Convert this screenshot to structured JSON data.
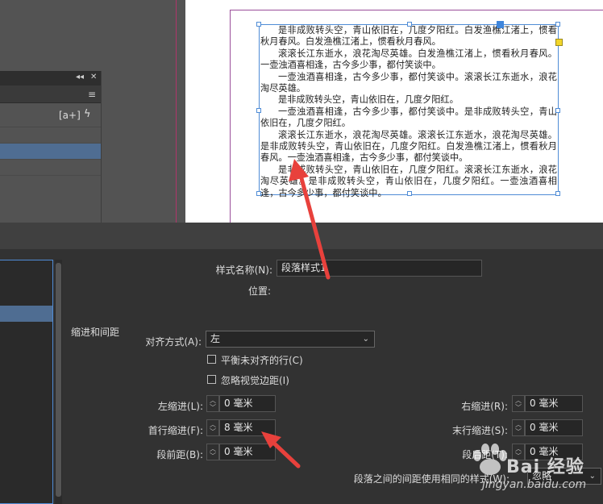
{
  "document": {
    "paragraphs": [
      "是非成败转头空，青山依旧在，几度夕阳红。白发渔樵江渚上，惯看秋月春风。白发渔樵江渚上，惯看秋月春风。",
      "滚滚长江东逝水，浪花淘尽英雄。白发渔樵江渚上，惯看秋月春风。一壶浊酒喜相逢，古今多少事，都付笑谈中。",
      "一壶浊酒喜相逢，古今多少事，都付笑谈中。滚滚长江东逝水，浪花淘尽英雄。",
      "是非成败转头空，青山依旧在，几度夕阳红。",
      "一壶浊酒喜相逢，古今多少事，都付笑谈中。是非成败转头空，青山依旧在，几度夕阳红。",
      "滚滚长江东逝水，浪花淘尽英雄。滚滚长江东逝水，浪花淘尽英雄。是非成败转头空，青山依旧在，几度夕阳红。白发渔樵江渚上，惯看秋月春风。一壶浊酒喜相逢，古今多少事，都付笑谈中。",
      "是非成败转头空，青山依旧在，几度夕阳红。滚滚长江东逝水，浪花淘尽英雄。是非成败转头空，青山依旧在，几度夕阳红。一壶浊酒喜相逢，古今多少事，都付笑谈中。"
    ]
  },
  "panel": {
    "icons": [
      "collapse-icon",
      "close-icon",
      "menu-icon",
      "text-insert-icon",
      "lightning-icon"
    ],
    "collapse_glyph": "◂◂",
    "close_glyph": "✕",
    "menu_glyph": "≡",
    "tool1": "[a+]",
    "tool2": "ϟ"
  },
  "dialog": {
    "style_name_label": "样式名称(N):",
    "style_name_value": "段落样式1",
    "location_label": "位置:",
    "section_title": "缩进和间距",
    "align_label": "对齐方式(A):",
    "align_value": "左",
    "balance_label": "平衡未对齐的行(C)",
    "ignore_margin_label": "忽略视觉边距(I)",
    "left_indent_label": "左缩进(L):",
    "left_indent_value": "0 毫米",
    "right_indent_label": "右缩进(R):",
    "right_indent_value": "0 毫米",
    "first_indent_label": "首行缩进(F):",
    "first_indent_value": "8 毫米",
    "last_indent_label": "末行缩进(S):",
    "last_indent_value": "0 毫米",
    "space_before_label": "段前距(B):",
    "space_before_value": "0 毫米",
    "space_after_label": "段后距(T):",
    "space_after_value": "0 毫米",
    "same_style_label": "段落之间的间距使用相同的样式(W):",
    "same_style_value": "忽略"
  },
  "watermark": {
    "brand": "Bai  经验",
    "url": "jingyan.baidu.com"
  },
  "colors": {
    "selection_blue": "#4f8cd6",
    "highlight_row": "#4f6d92",
    "arrow_red": "#e8413c",
    "port_yellow": "#f2d62a"
  }
}
